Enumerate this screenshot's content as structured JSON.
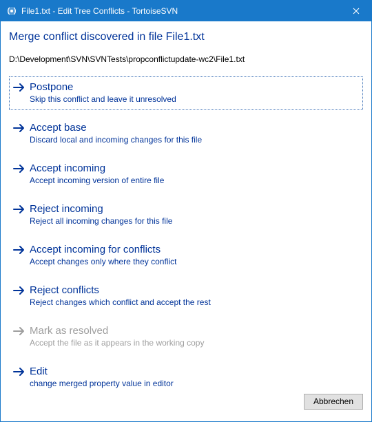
{
  "titlebar": {
    "title": "File1.txt - Edit Tree Conflicts - TortoiseSVN"
  },
  "heading": "Merge conflict discovered in file File1.txt",
  "filepath": "D:\\Development\\SVN\\SVNTests\\propconflictupdate-wc2\\File1.txt",
  "options": [
    {
      "title": "Postpone",
      "desc": "Skip this conflict and leave it unresolved",
      "enabled": true,
      "selected": true
    },
    {
      "title": "Accept base",
      "desc": "Discard local and incoming changes for this file",
      "enabled": true,
      "selected": false
    },
    {
      "title": "Accept incoming",
      "desc": "Accept incoming version of entire file",
      "enabled": true,
      "selected": false
    },
    {
      "title": "Reject incoming",
      "desc": "Reject all incoming changes for this file",
      "enabled": true,
      "selected": false
    },
    {
      "title": "Accept incoming for conflicts",
      "desc": "Accept changes only where they conflict",
      "enabled": true,
      "selected": false
    },
    {
      "title": "Reject conflicts",
      "desc": "Reject changes which conflict and accept the rest",
      "enabled": true,
      "selected": false
    },
    {
      "title": "Mark as resolved",
      "desc": "Accept the file as it appears in the working copy",
      "enabled": false,
      "selected": false
    },
    {
      "title": "Edit",
      "desc": "change merged property value in editor",
      "enabled": true,
      "selected": false
    }
  ],
  "footer": {
    "cancel_label": "Abbrechen"
  },
  "colors": {
    "accent": "#1979ca",
    "link": "#003399",
    "disabled": "#9e9e9e"
  }
}
